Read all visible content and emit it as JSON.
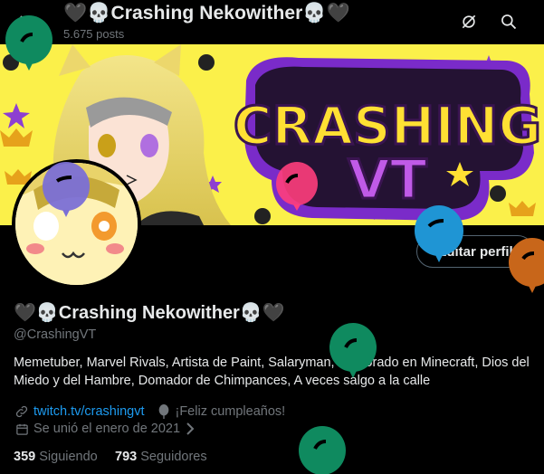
{
  "header": {
    "title": "🖤💀Crashing Nekowither💀🖤",
    "post_count": "5.675 posts"
  },
  "banner": {
    "text_line1": "CRASHING",
    "text_line2": "VT"
  },
  "profile": {
    "edit_button": "Editar perfil",
    "display_name": "🖤💀Crashing Nekowither💀🖤",
    "handle": "@CrashingVT",
    "bio": "Memetuber, Marvel Rivals, Artista de Paint, Salaryman, Doctorado en Minecraft, Dios del Miedo y del Hambre, Domador de Chimpances, A veces salgo a la calle",
    "link": "twitch.tv/crashingvt",
    "birthday": "¡Feliz cumpleaños!",
    "joined": "Se unió el enero de 2021",
    "following_count": "359",
    "following_label": "Siguiendo",
    "followers_count": "793",
    "followers_label": "Seguidores"
  },
  "colors": {
    "accent": "#1d9bf0",
    "muted": "#71767b",
    "balloon_green": "#0f8a5f",
    "balloon_purple": "#7b6fd6",
    "balloon_blue": "#1f95d4",
    "balloon_orange": "#c8661a",
    "balloon_pink": "#ff3e7c"
  },
  "icons": [
    "back-arrow-icon",
    "no-notifications-icon",
    "search-icon",
    "link-icon",
    "balloon-icon",
    "calendar-icon",
    "chevron-right-icon",
    "verified-icon"
  ]
}
